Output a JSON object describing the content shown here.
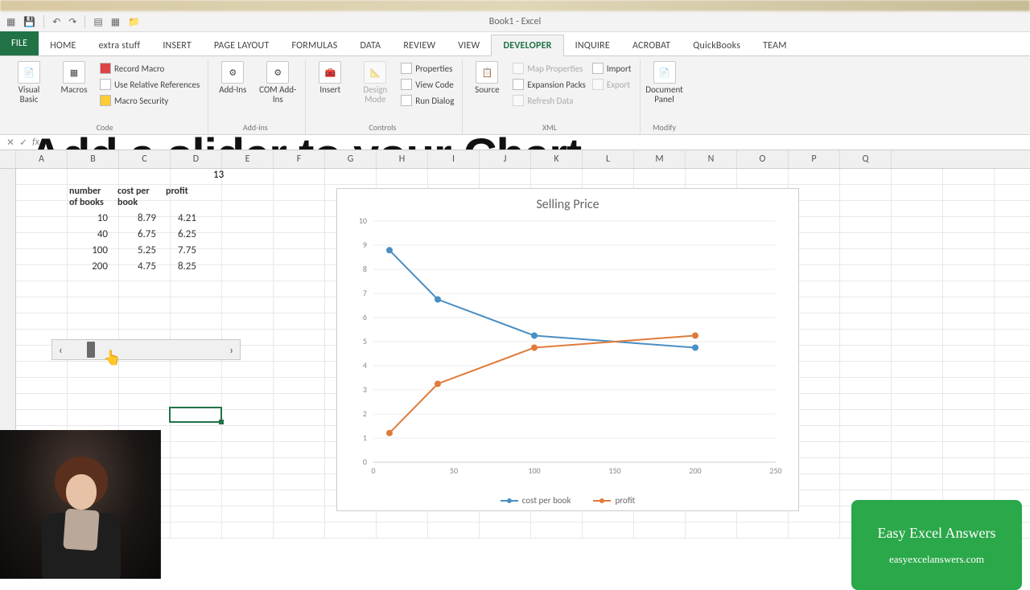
{
  "app_title": "Book1 - Excel",
  "qat_icons": [
    "save-icon",
    "undo-icon",
    "redo-icon",
    "grid-icon",
    "table-icon",
    "folder-icon"
  ],
  "tabs": [
    "FILE",
    "HOME",
    "extra stuff",
    "INSERT",
    "PAGE LAYOUT",
    "FORMULAS",
    "DATA",
    "REVIEW",
    "VIEW",
    "DEVELOPER",
    "INQUIRE",
    "ACROBAT",
    "QuickBooks",
    "TEAM"
  ],
  "active_tab": "DEVELOPER",
  "ribbon": {
    "code": {
      "visual_basic": "Visual\nBasic",
      "macros": "Macros",
      "record_macro": "Record Macro",
      "use_relative": "Use Relative References",
      "macro_security": "Macro Security",
      "label": "Code"
    },
    "addins": {
      "addins": "Add-Ins",
      "com": "COM\nAdd-Ins",
      "label": "Add-ins"
    },
    "controls": {
      "insert": "Insert",
      "design": "Design\nMode",
      "properties": "Properties",
      "view_code": "View Code",
      "run_dialog": "Run Dialog",
      "label": "Controls"
    },
    "xml": {
      "source": "Source",
      "map_props": "Map Properties",
      "expansion": "Expansion Packs",
      "refresh": "Refresh Data",
      "import": "Import",
      "export": "Export",
      "label": "XML"
    },
    "modify": {
      "doc_panel": "Document\nPanel",
      "label": "Modify"
    }
  },
  "headline": "Add a slider to your Chart",
  "columns": [
    "A",
    "B",
    "C",
    "D",
    "E",
    "F",
    "G",
    "H",
    "I",
    "J",
    "K",
    "L",
    "M",
    "N",
    "O",
    "P",
    "Q"
  ],
  "cell_d1": "13",
  "table": {
    "headers": [
      "number of books",
      "cost per book",
      "profit"
    ],
    "rows": [
      [
        "10",
        "8.79",
        "4.21"
      ],
      [
        "40",
        "6.75",
        "6.25"
      ],
      [
        "100",
        "5.25",
        "7.75"
      ],
      [
        "200",
        "4.75",
        "8.25"
      ]
    ]
  },
  "chart_data": {
    "type": "line",
    "title": "Selling Price",
    "x": [
      10,
      40,
      100,
      200
    ],
    "series": [
      {
        "name": "cost per book",
        "values": [
          8.79,
          6.75,
          5.25,
          4.75
        ],
        "color": "#4a8fc4"
      },
      {
        "name": "profit",
        "values": [
          1.21,
          3.25,
          4.75,
          5.25
        ],
        "color": "#e07b3a"
      }
    ],
    "xlabel": "",
    "ylabel": "",
    "xlim": [
      0,
      250
    ],
    "ylim": [
      0,
      10
    ],
    "xticks": [
      0,
      50,
      100,
      150,
      200,
      250
    ],
    "yticks": [
      0,
      1,
      2,
      3,
      4,
      5,
      6,
      7,
      8,
      9,
      10
    ],
    "legend_position": "bottom",
    "grid": true
  },
  "promo": {
    "line1": "Easy Excel Answers",
    "line2": "easyexcelanswers.com"
  },
  "colors": {
    "accent": "#217346",
    "promo": "#2ba84a",
    "series1": "#4a8fc4",
    "series2": "#e07b3a"
  }
}
